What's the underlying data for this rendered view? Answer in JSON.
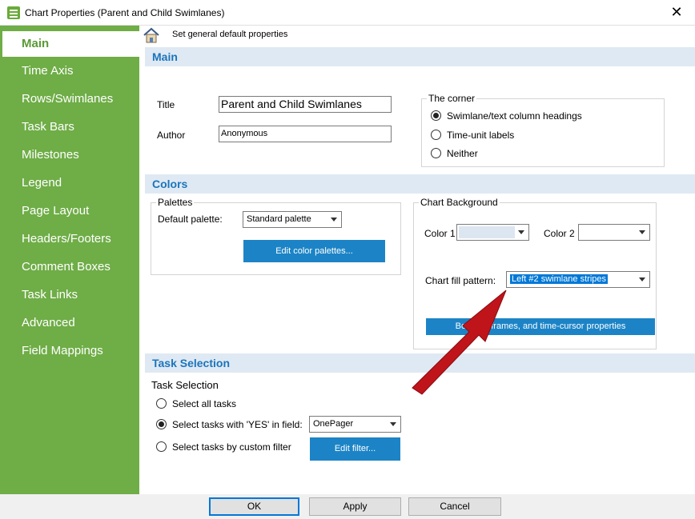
{
  "window": {
    "title": "Chart Properties (Parent and Child Swimlanes)",
    "close_glyph": "✕"
  },
  "sidebar": {
    "items": [
      {
        "label": "Main"
      },
      {
        "label": "Time Axis"
      },
      {
        "label": "Rows/Swimlanes"
      },
      {
        "label": "Task Bars"
      },
      {
        "label": "Milestones"
      },
      {
        "label": "Legend"
      },
      {
        "label": "Page Layout"
      },
      {
        "label": "Headers/Footers"
      },
      {
        "label": "Comment Boxes"
      },
      {
        "label": "Task Links"
      },
      {
        "label": "Advanced"
      },
      {
        "label": "Field Mappings"
      }
    ]
  },
  "breadcrumb": {
    "text": "Set general default properties"
  },
  "main": {
    "header": "Main",
    "title_label": "Title",
    "title_value": "Parent and Child Swimlanes",
    "author_label": "Author",
    "author_value": "Anonymous",
    "corner": {
      "legend": "The corner",
      "options": [
        "Swimlane/text column headings",
        "Time-unit labels",
        "Neither"
      ],
      "selected_index": 0
    }
  },
  "colors": {
    "header": "Colors",
    "palettes": {
      "legend": "Palettes",
      "default_palette_label": "Default palette:",
      "default_palette_value": "Standard palette",
      "edit_button": "Edit color palettes..."
    },
    "background": {
      "legend": "Chart Background",
      "color1_label": "Color 1",
      "color2_label": "Color 2",
      "color1_swatch": "#dce6f1",
      "fill_label": "Chart fill pattern:",
      "fill_value": "Left #2 swimlane stripes",
      "borders_button": "Borders, frames, and time-cursor properties"
    }
  },
  "task_selection": {
    "header": "Task Selection",
    "sub_label": "Task Selection",
    "options": [
      "Select all tasks",
      "Select tasks with 'YES' in field:",
      "Select tasks by custom filter"
    ],
    "selected_index": 1,
    "field_value": "OnePager",
    "edit_filter_button": "Edit filter..."
  },
  "footer": {
    "ok": "OK",
    "apply": "Apply",
    "cancel": "Cancel"
  },
  "colors_theme": {
    "sidebar_green": "#6fad47",
    "accent_blue": "#1c84c6",
    "header_blue": "#1b75bb",
    "arrow_red": "#c0141b"
  }
}
